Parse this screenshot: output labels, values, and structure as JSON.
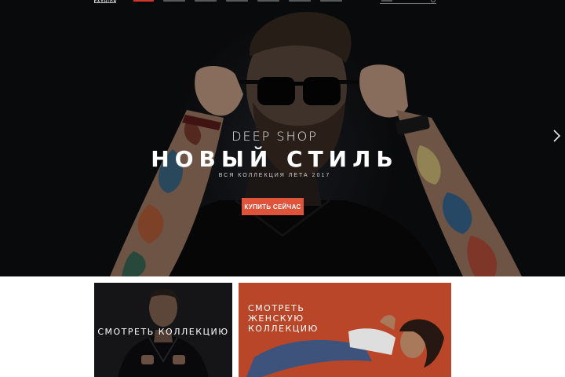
{
  "brand": {
    "logo_text": "FASHION"
  },
  "hero": {
    "eyebrow": "DEEP SHOP",
    "title": "НОВЫЙ СТИЛЬ",
    "subtitle": "ВСЯ КОЛЛЕКЦИЯ ЛЕТА 2017",
    "cta_label": "КУПИТЬ СЕЙЧАС",
    "next_icon": "chevron-right-icon"
  },
  "collections": {
    "men_label": "СМОТРЕТЬ КОЛЛЕКЦИЮ",
    "women_label": "СМОТРЕТЬ ЖЕНСКУЮ КОЛЛЕКЦИЮ"
  },
  "colors": {
    "accent": "#e0533b",
    "nav_active": "#d8352a",
    "hero_bg": "#0f1012",
    "women_tile_bg": "#d4532f"
  }
}
